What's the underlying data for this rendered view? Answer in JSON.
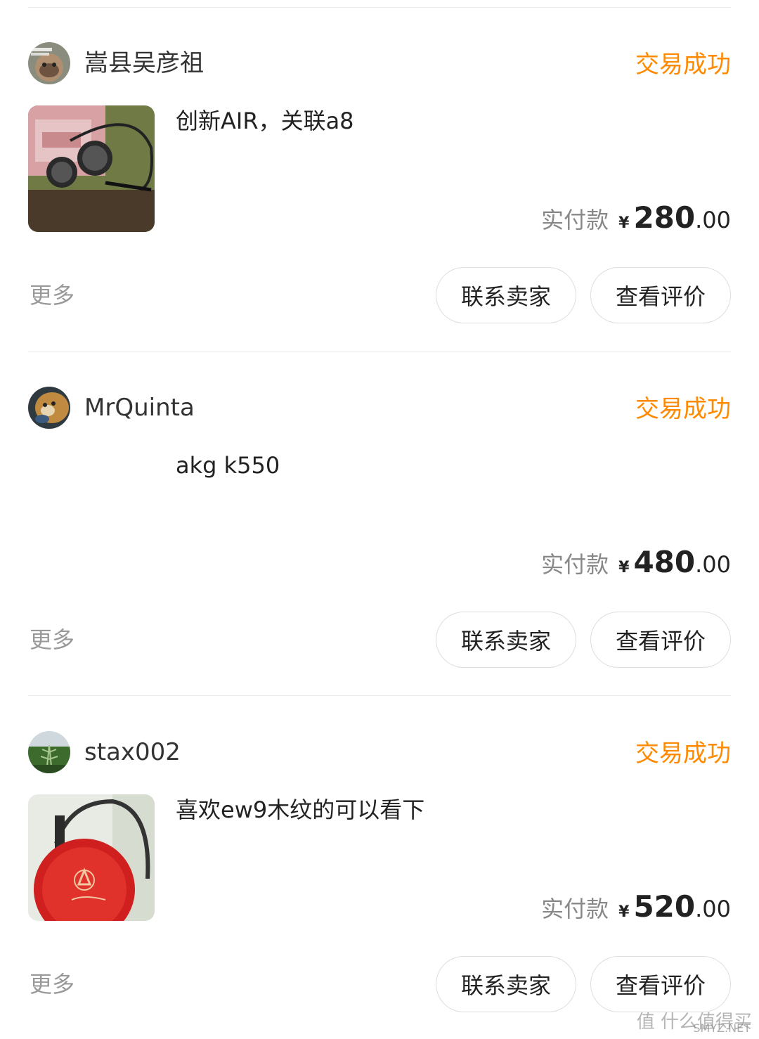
{
  "orders": [
    {
      "seller": "嵩县吴彦祖",
      "status": "交易成功",
      "title": "创新AIR，关联a8",
      "price_label": "实付款",
      "currency": "¥",
      "price_int": "280",
      "price_dec": ".00",
      "more": "更多",
      "contact_label": "联系卖家",
      "review_label": "查看评价",
      "has_image": true
    },
    {
      "seller": "MrQuinta",
      "status": "交易成功",
      "title": "akg k550",
      "price_label": "实付款",
      "currency": "¥",
      "price_int": "480",
      "price_dec": ".00",
      "more": "更多",
      "contact_label": "联系卖家",
      "review_label": "查看评价",
      "has_image": false
    },
    {
      "seller": "stax002",
      "status": "交易成功",
      "title": "喜欢ew9木纹的可以看下",
      "price_label": "实付款",
      "currency": "¥",
      "price_int": "520",
      "price_dec": ".00",
      "more": "更多",
      "contact_label": "联系卖家",
      "review_label": "查看评价",
      "has_image": true
    }
  ],
  "watermark": {
    "text": "值 什么值得买",
    "small": "SMYZ.NET"
  },
  "colors": {
    "status": "#ff8a00",
    "muted": "#888888",
    "divider": "#ececec"
  }
}
